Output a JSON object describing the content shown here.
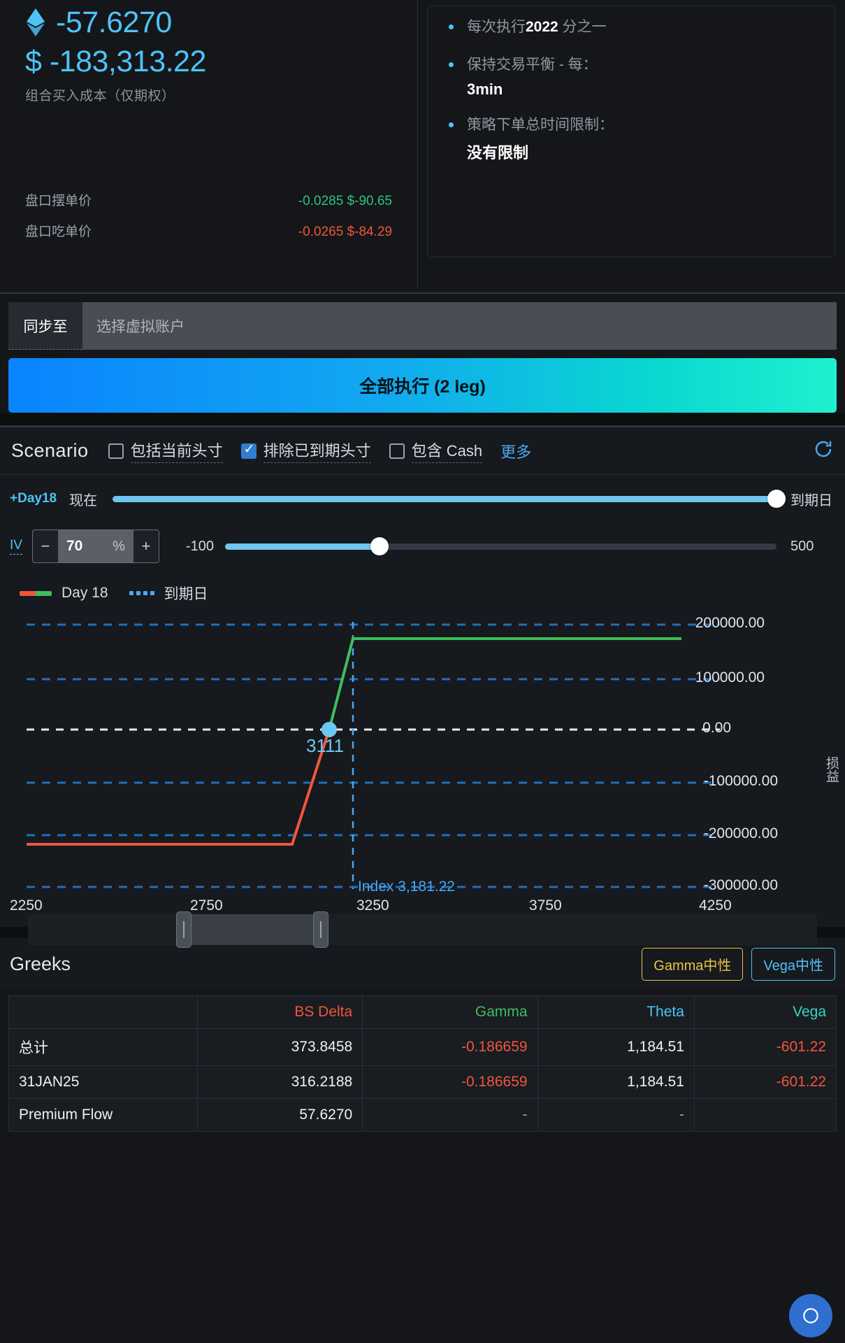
{
  "cost": {
    "eth_icon": "ethereum-diamond-icon",
    "eth_value": "-57.6270",
    "usd_value": "$ -183,313.22",
    "label": "组合买入成本（仅期权）"
  },
  "quotes": [
    {
      "label": "盘口摆单价",
      "value": "-0.0285 $-90.65",
      "tone": "green"
    },
    {
      "label": "盘口吃单价",
      "value": "-0.0265 $-84.29",
      "tone": "red"
    }
  ],
  "strategy_bullets": [
    {
      "prefix": "每次执行",
      "strong": "2022",
      "suffix": " 分之一",
      "value": ""
    },
    {
      "prefix": "保持交易平衡 - 每：",
      "strong": "",
      "suffix": "",
      "value": "3min"
    },
    {
      "prefix": "策略下单总时间限制：",
      "strong": "",
      "suffix": "",
      "value": "没有限制"
    }
  ],
  "sync": {
    "label": "同步至",
    "placeholder": "选择虚拟账户",
    "value": ""
  },
  "execute": {
    "label": "全部执行 (2 leg)"
  },
  "scenario": {
    "title": "Scenario",
    "checkboxes": [
      {
        "label": "包括当前头寸",
        "checked": false,
        "dashed": true
      },
      {
        "label": "排除已到期头寸",
        "checked": true,
        "dashed": true
      },
      {
        "label": "包含 Cash",
        "checked": false,
        "dashed": true
      }
    ],
    "more_label": "更多",
    "refresh_icon": "refresh-icon",
    "day_slider": {
      "tag": "+Day18",
      "start_label": "现在",
      "end_label": "到期日",
      "percent": 100
    },
    "iv_slider": {
      "label": "IV",
      "minus": "−",
      "plus": "+",
      "value": "70",
      "unit": "%",
      "min_label": "-100",
      "max_label": "500",
      "percent": 28
    }
  },
  "chart_legend": {
    "line_label": "Day 18",
    "dotted_label": "到期日"
  },
  "chart_data": {
    "type": "line",
    "title": "",
    "xlabel": "",
    "ylabel": "损益",
    "xlim": [
      2250,
      4400
    ],
    "ylim": [
      -330000,
      230000
    ],
    "xticks": [
      2250,
      2750,
      3250,
      3750,
      4250
    ],
    "yticks": [
      200000,
      100000,
      0,
      -100000,
      -200000,
      -300000
    ],
    "ytick_labels": [
      "200000.00",
      "100000.00",
      "0.00",
      "-100000.00",
      "-200000.00",
      "-300000.00"
    ],
    "grid": true,
    "legend_position": "top-left",
    "annotations": [
      {
        "name": "index-marker",
        "label": "Index 3,181.22",
        "x": 3181.22
      },
      {
        "name": "breakeven-marker",
        "label": "3111",
        "x": 3111,
        "y": 0
      }
    ],
    "series": [
      {
        "name": "Day 18",
        "style": "solid",
        "segments": [
          {
            "color": "#f0563a",
            "points": [
              [
                2250,
                -215000
              ],
              [
                2930,
                -215000
              ],
              [
                3111,
                0
              ]
            ]
          },
          {
            "color": "#3fbd5f",
            "points": [
              [
                3111,
                0
              ],
              [
                3230,
                172000
              ],
              [
                4320,
                172000
              ]
            ]
          }
        ]
      }
    ]
  },
  "range_scroll": {
    "name": "chart-range-scrollbar"
  },
  "greeks": {
    "title": "Greeks",
    "badges": [
      {
        "label": "Gamma中性",
        "tone": "gamma"
      },
      {
        "label": "Vega中性",
        "tone": "vega"
      }
    ],
    "columns": [
      "",
      "BS Delta",
      "Gamma",
      "Theta",
      "Vega"
    ],
    "rows": [
      {
        "name": "总计",
        "delta": "373.8458",
        "gamma": "-0.186659",
        "theta": "1,184.51",
        "vega": "-601.22"
      },
      {
        "name": "31JAN25",
        "delta": "316.2188",
        "gamma": "-0.186659",
        "theta": "1,184.51",
        "vega": "-601.22"
      },
      {
        "name": "Premium Flow",
        "delta": "57.6270",
        "gamma": "-",
        "theta": "-",
        "vega": ""
      }
    ]
  }
}
